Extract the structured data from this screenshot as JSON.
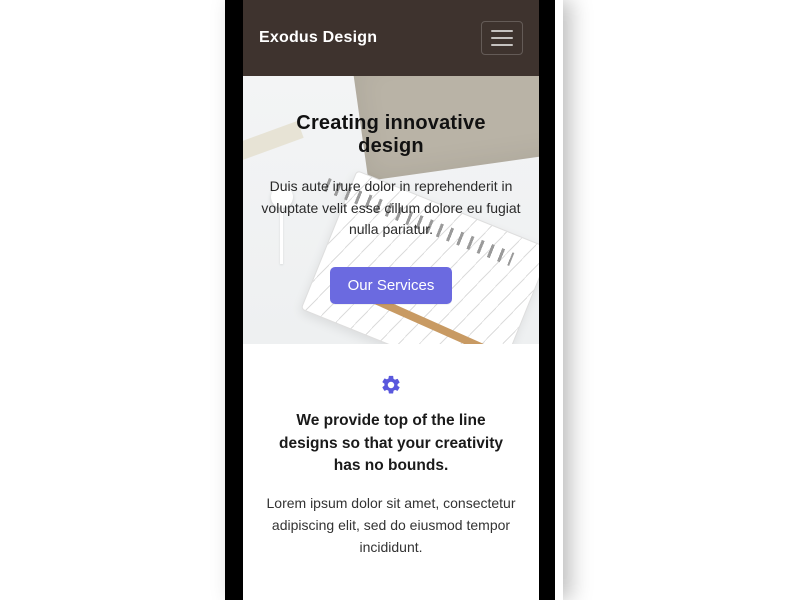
{
  "colors": {
    "accent": "#6b6ae0",
    "navbar_bg": "#3e332e"
  },
  "navbar": {
    "brand": "Exodus Design"
  },
  "hero": {
    "title": "Creating innovative design",
    "body": "Duis aute irure dolor in reprehenderit in voluptate velit esse cillum dolore eu fugiat nulla pariatur.",
    "cta_label": "Our Services"
  },
  "feature": {
    "icon": "gear-icon",
    "title": "We provide top of the line designs so that your creativity has no bounds.",
    "body": "Lorem ipsum dolor sit amet, consectetur adipiscing elit, sed do eiusmod tempor incididunt."
  }
}
